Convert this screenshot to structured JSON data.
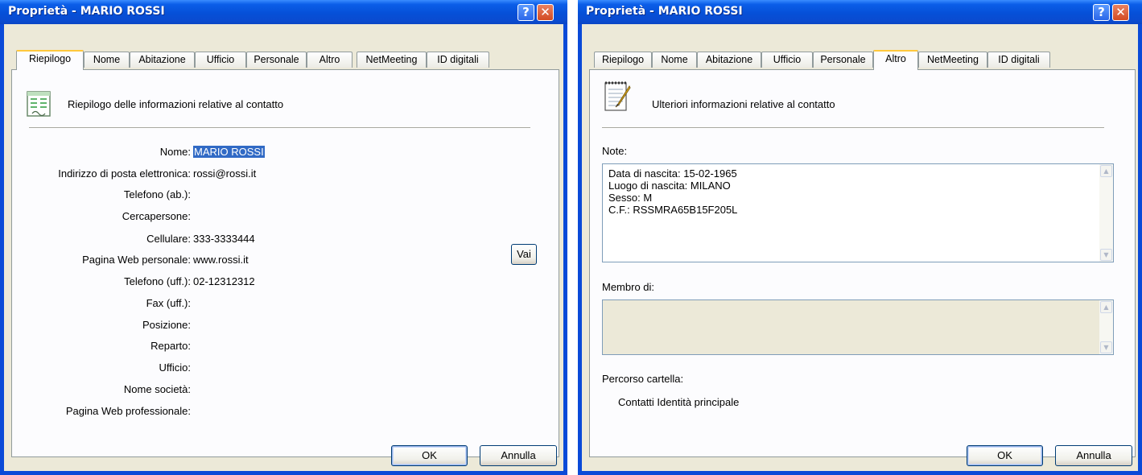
{
  "left": {
    "title": "Proprietà - MARIO ROSSI",
    "tabs": [
      "Riepilogo",
      "Nome",
      "Abitazione",
      "Ufficio",
      "Personale",
      "Altro",
      "NetMeeting",
      "ID digitali"
    ],
    "active_tab": "Riepilogo",
    "header": "Riepilogo delle informazioni relative al contatto",
    "fields": [
      {
        "label": "Nome:",
        "value": "MARIO ROSSI"
      },
      {
        "label": "Indirizzo di posta elettronica:",
        "value": "rossi@rossi.it"
      },
      {
        "label": "Telefono (ab.):",
        "value": ""
      },
      {
        "label": "Cercapersone:",
        "value": ""
      },
      {
        "label": "Cellulare:",
        "value": "333-3333444"
      },
      {
        "label": "Pagina Web personale:",
        "value": "www.rossi.it"
      },
      {
        "label": "Telefono (uff.):",
        "value": "02-12312312"
      },
      {
        "label": "Fax (uff.):",
        "value": ""
      },
      {
        "label": "Posizione:",
        "value": ""
      },
      {
        "label": "Reparto:",
        "value": ""
      },
      {
        "label": "Ufficio:",
        "value": ""
      },
      {
        "label": "Nome società:",
        "value": ""
      },
      {
        "label": "Pagina Web professionale:",
        "value": ""
      }
    ],
    "vai_label": "Vai",
    "ok_label": "OK",
    "cancel_label": "Annulla"
  },
  "right": {
    "title": "Proprietà - MARIO ROSSI",
    "tabs": [
      "Riepilogo",
      "Nome",
      "Abitazione",
      "Ufficio",
      "Personale",
      "Altro",
      "NetMeeting",
      "ID digitali"
    ],
    "active_tab": "Altro",
    "header": "Ulteriori informazioni relative al contatto",
    "notes_label": "Note:",
    "notes_lines": [
      "Data di nascita: 15-02-1965",
      "Luogo di nascita: MILANO",
      "Sesso: M",
      "C.F.: RSSMRA65B15F205L"
    ],
    "member_label": "Membro di:",
    "folder_label": "Percorso cartella:",
    "folder_value": "Contatti Identità principale",
    "ok_label": "OK",
    "cancel_label": "Annulla"
  },
  "colors": {
    "titlebar": "#0a4ad8",
    "dialog_bg": "#ece9d8",
    "selection": "#316ac5",
    "active_tab_accent": "#ffc83c"
  },
  "icons": {
    "help": "help-icon",
    "close": "close-icon",
    "summary": "contact-card-icon",
    "notes": "notepad-pencil-icon",
    "scroll_up": "scroll-up-icon",
    "scroll_down": "scroll-down-icon"
  }
}
